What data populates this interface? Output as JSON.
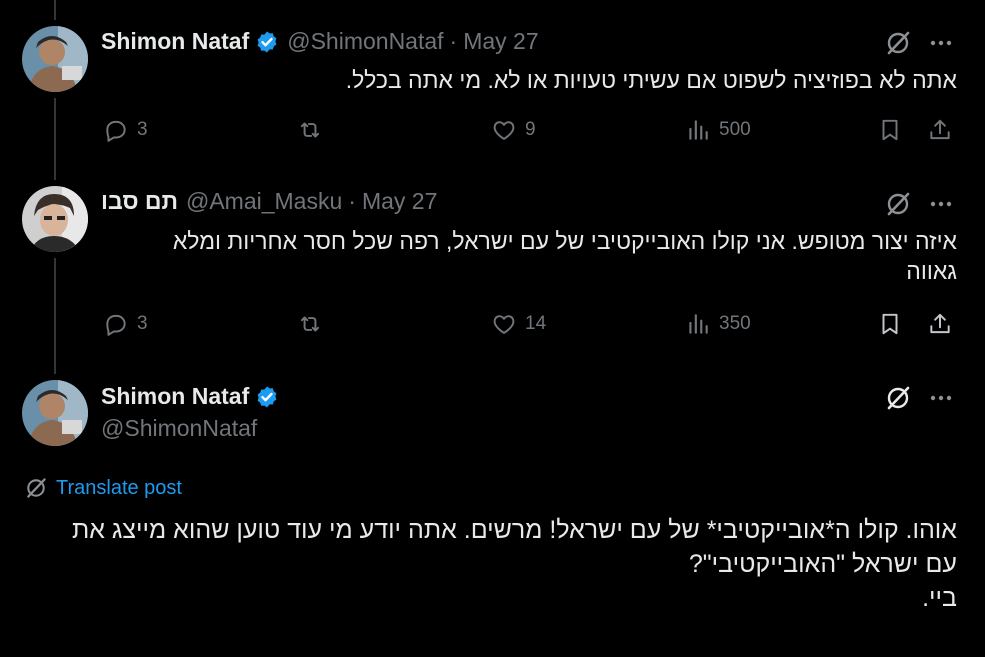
{
  "tweets": [
    {
      "name": "Shimon Nataf",
      "handle": "@ShimonNataf",
      "separator": "·",
      "date": "May 27",
      "text": "אתה לא בפוזיציה לשפוט אם עשיתי טעויות או לא. מי אתה בכלל.",
      "replies": "3",
      "likes": "9",
      "views": "500"
    },
    {
      "name": "תם סבו",
      "handle": "@Amai_Masku",
      "separator": "·",
      "date": "May 27",
      "text": "איזה יצור מטופש. אני קולו האובייקטיבי של עם ישראל, רפה שכל חסר אחריות ומלא גאווה",
      "replies": "3",
      "likes": "14",
      "views": "350"
    },
    {
      "name": "Shimon Nataf",
      "handle": "@ShimonNataf",
      "translate_label": "Translate post",
      "text": "אוהו. קולו ה*אובייקטיבי* של עם ישראל! מרשים. אתה יודע מי עוד טוען שהוא מייצג את עם ישראל \"האובייקטיבי\"?\nביי."
    }
  ],
  "colors": {
    "background": "#000000",
    "text": "#e7e9ea",
    "muted": "#71767b",
    "accent": "#1d9bf0"
  },
  "icons": [
    "verified-badge-icon",
    "grok-icon",
    "more-icon",
    "reply-icon",
    "retweet-icon",
    "like-icon",
    "views-icon",
    "bookmark-icon",
    "share-icon",
    "translate-icon"
  ]
}
